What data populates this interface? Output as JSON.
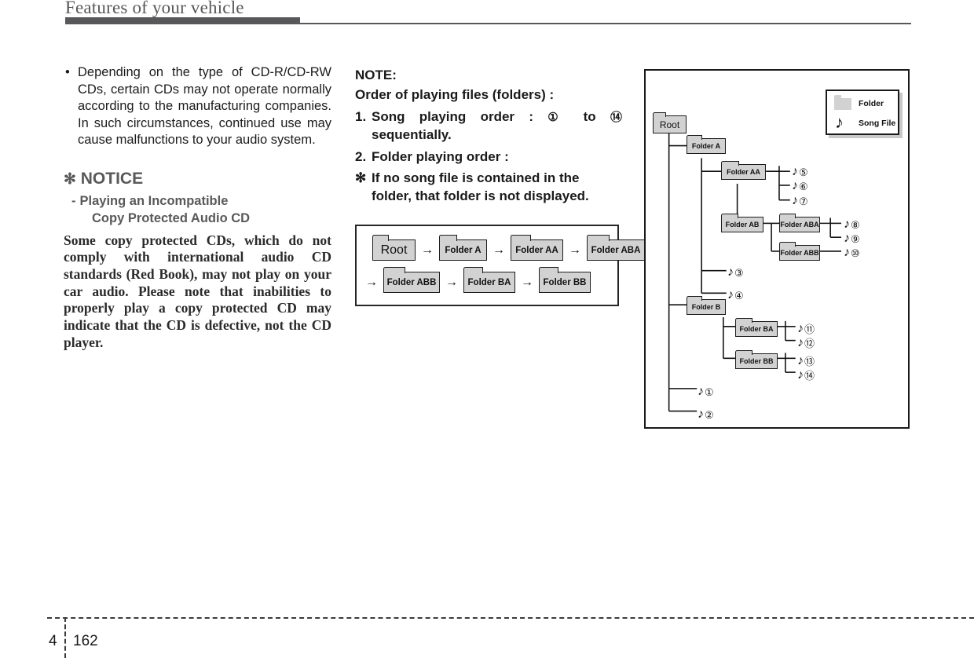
{
  "header": {
    "title": "Features of your vehicle"
  },
  "left_column": {
    "bullet": {
      "marker": "•",
      "text": "Depending on the type of CD-R/CD-RW CDs, certain CDs may not operate normally according to the manufacturing companies. In such circumstances, continued use may cause malfunctions to your audio system."
    },
    "notice": {
      "star": "✻",
      "heading": "NOTICE",
      "dash": "-",
      "subheading_line1": "Playing an Incompatible",
      "subheading_line2": "Copy Protected Audio CD",
      "body": "Some copy protected CDs, which do not comply with  international audio CD standards (Red Book), may not play on your car audio. Please note that inabilities to properly play a copy protected CD may indicate that the CD is defective, not the CD player."
    }
  },
  "middle_column": {
    "note_label": "NOTE:",
    "order_title": "Order of playing files (folders) :",
    "item1": {
      "number": "1.",
      "line1": "Song playing order :",
      "from": "①",
      "to_word": "to",
      "to": "⑭",
      "line2": "sequentially."
    },
    "item2": {
      "number": "2.",
      "text": "Folder playing order :"
    },
    "item3": {
      "star": "✻",
      "line1": "If no song file is contained in the",
      "line2": "folder, that folder is not displayed."
    }
  },
  "flow_diagram": {
    "arrow": "→",
    "row1": [
      "Root",
      "Folder A",
      "Folder AA",
      "Folder ABA"
    ],
    "row2": [
      "Folder ABB",
      "Folder BA",
      "Folder BB"
    ]
  },
  "tree_diagram": {
    "legend": {
      "folder_label": "Folder",
      "song_label": "Song File",
      "note_glyph": "♪"
    },
    "note_glyph": "♪",
    "nodes": {
      "root": "Root",
      "folder_a": "Folder A",
      "folder_aa": "Folder AA",
      "folder_ab": "Folder AB",
      "folder_aba": "Folder ABA",
      "folder_abb": "Folder ABB",
      "folder_b": "Folder B",
      "folder_ba": "Folder BA",
      "folder_bb": "Folder BB"
    },
    "songs": {
      "s1": "①",
      "s2": "②",
      "s3": "③",
      "s4": "④",
      "s5": "⑤",
      "s6": "⑥",
      "s7": "⑦",
      "s8": "⑧",
      "s9": "⑨",
      "s10": "⑩",
      "s11": "⑪",
      "s12": "⑫",
      "s13": "⑬",
      "s14": "⑭"
    }
  },
  "footer": {
    "chapter": "4",
    "page": "162"
  }
}
